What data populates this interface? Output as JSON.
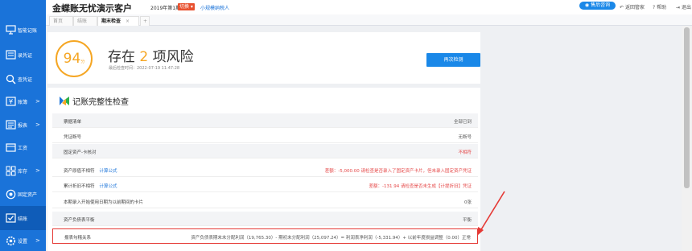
{
  "header": {
    "company": "金蝶账无忧演示客户",
    "period": "2019年第1期",
    "switch_label": "切换",
    "taxpayer_type": "小规模纳税人",
    "service_label": "售后咨询",
    "links": [
      "返回管家",
      "帮助",
      "退出"
    ]
  },
  "tabs": [
    {
      "label": "首页"
    },
    {
      "label": "结账"
    },
    {
      "label": "期末检查"
    },
    {
      "label": "+"
    }
  ],
  "sidebar": {
    "items": [
      {
        "label": "智能记账",
        "icon": "monitor-icon",
        "chevron": ""
      },
      {
        "label": "录凭证",
        "icon": "voucher-icon",
        "chevron": ""
      },
      {
        "label": "查凭证",
        "icon": "search-icon",
        "chevron": ""
      },
      {
        "label": "账簿",
        "icon": "yen-icon",
        "chevron": ">"
      },
      {
        "label": "报表",
        "icon": "report-icon",
        "chevron": ">"
      },
      {
        "label": "工资",
        "icon": "calendar-icon",
        "chevron": ""
      },
      {
        "label": "库存",
        "icon": "grid-icon",
        "chevron": ">"
      },
      {
        "label": "固定资产",
        "icon": "asset-icon",
        "chevron": ""
      },
      {
        "label": "结账",
        "icon": "check-icon",
        "chevron": ""
      },
      {
        "label": "设置",
        "icon": "gear-icon",
        "chevron": ">"
      }
    ]
  },
  "risk": {
    "score": "94",
    "score_unit": "分",
    "title_prefix": "存在",
    "count": "2",
    "title_suffix": "项风险",
    "last_check": "最后检查时间：2022-07-19 11:47:28",
    "recheck_label": "再次检测"
  },
  "section": {
    "title": "记账完整性检查",
    "rows": [
      {
        "label": "票据清单",
        "link": "",
        "result": "全部已到",
        "red": false
      },
      {
        "label": "凭证断号",
        "link": "",
        "result": "无断号",
        "red": false
      },
      {
        "label": "固定资产-卡核对",
        "link": "",
        "result": "不相符",
        "red": true
      },
      {
        "label": "资产原值不相符",
        "link": "计算公式",
        "result": "差额：-5,000.00 请检查是否录入了固定资产卡片，但未录入固定资产凭证",
        "red": true
      },
      {
        "label": "累计折旧不相符",
        "link": "计算公式",
        "result": "差额：-131.94 请检查是否未生成【计提折旧】凭证",
        "red": true
      },
      {
        "label": "本期录入开始使用日期为以前期间的卡片",
        "link": "",
        "result": "0张",
        "red": false
      },
      {
        "label": "资产负债表平衡",
        "link": "",
        "result": "平衡",
        "red": false
      },
      {
        "label": "报表勾稽关系",
        "link": "",
        "result": "资产负债表期末未分配利润（19,765.30）- 期初未分配利润（25,097.24）= 利润表净利润（-5,331.94）+ 以前年度损益调整（0.00）正常",
        "red": false
      }
    ]
  },
  "colors": {
    "sidebar": "#1a73d9",
    "accent": "#f5a623",
    "primary_button": "#1a88e8",
    "risk_red": "#e54848",
    "highlight_border": "#e53935"
  }
}
